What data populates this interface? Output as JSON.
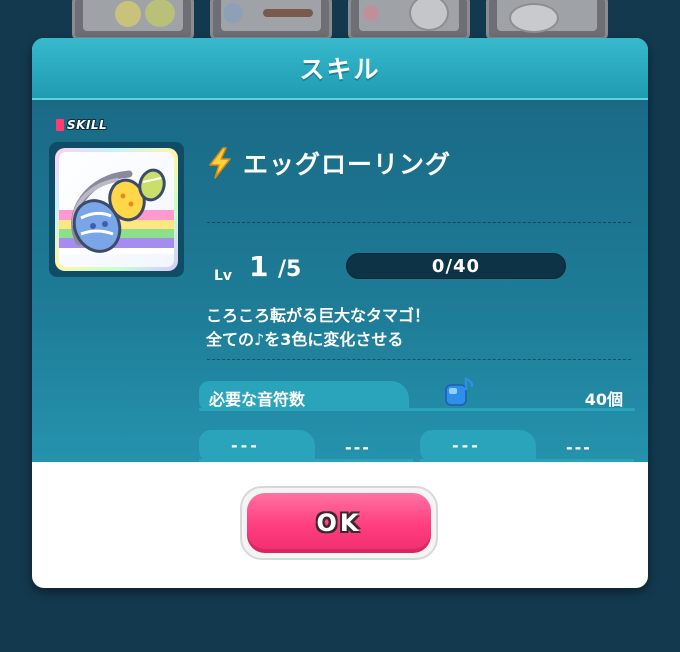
{
  "dialog": {
    "title": "スキル",
    "skill_tag": "SKILL",
    "skill_name": "エッグローリング",
    "icon": "lightning-icon"
  },
  "level": {
    "label": "Lv",
    "current": "1",
    "max": "/5"
  },
  "exp": {
    "text": "0/40",
    "fraction": 0
  },
  "description": {
    "line1": "ころころ転がる巨大なタマゴ！",
    "line2": "全ての♪を3色に変化させる"
  },
  "required_notes": {
    "label": "必要な音符数",
    "icon": "blue-note-icon",
    "count": "40個"
  },
  "slots": [
    {
      "a": "---",
      "b": "---"
    },
    {
      "a": "---",
      "b": "---"
    }
  ],
  "buttons": {
    "ok": "OK"
  },
  "colors": {
    "header": "#1f9cb2",
    "body": "#1e7d98",
    "ok_button": "#ff3d7f",
    "skill_tag": "#ff3b72"
  }
}
